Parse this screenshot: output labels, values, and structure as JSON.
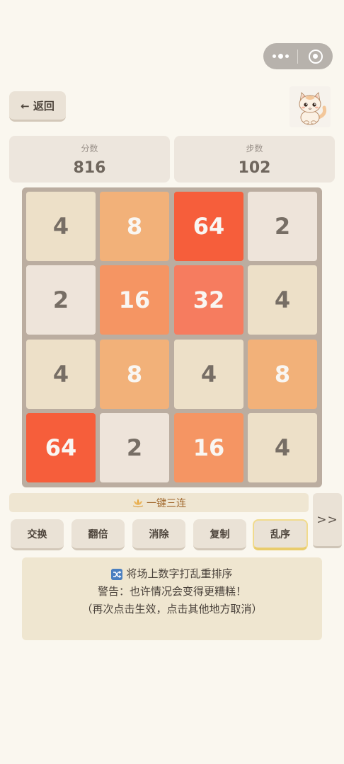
{
  "header": {
    "back_label": "← 返回",
    "avatar_icon": "cat-icon"
  },
  "stats": {
    "score_label": "分数",
    "score_value": "816",
    "steps_label": "步数",
    "steps_value": "102"
  },
  "board": {
    "rows": [
      [
        "4",
        "8",
        "64",
        "2"
      ],
      [
        "2",
        "16",
        "32",
        "4"
      ],
      [
        "4",
        "8",
        "4",
        "8"
      ],
      [
        "64",
        "2",
        "16",
        "4"
      ]
    ]
  },
  "tile_colors": {
    "2": {
      "bg": "#eee4da",
      "fg": "#776e65"
    },
    "4": {
      "bg": "#ede0c8",
      "fg": "#776e65"
    },
    "8": {
      "bg": "#f2b179",
      "fg": "#f9f6f2"
    },
    "16": {
      "bg": "#f59563",
      "fg": "#f9f6f2"
    },
    "32": {
      "bg": "#f67c5f",
      "fg": "#f9f6f2"
    },
    "64": {
      "bg": "#f65e3b",
      "fg": "#f9f6f2"
    }
  },
  "combo": {
    "icon": "lotus-icon",
    "label": "一键三连"
  },
  "more_label": ">>",
  "tools": [
    {
      "label": "交换",
      "active": false
    },
    {
      "label": "翻倍",
      "active": false
    },
    {
      "label": "消除",
      "active": false
    },
    {
      "label": "复制",
      "active": false
    },
    {
      "label": "乱序",
      "active": true
    }
  ],
  "info": {
    "icon": "shuffle-icon",
    "line1": "将场上数字打乱重排序",
    "line2": "警告：也许情况会变得更糟糕！",
    "line3": "（再次点击生效，点击其他地方取消）"
  }
}
